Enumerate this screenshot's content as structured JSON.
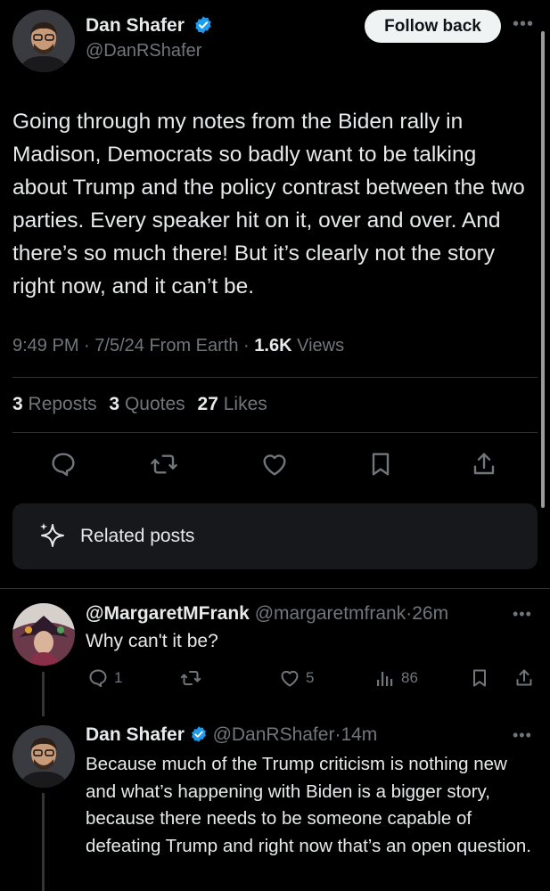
{
  "main_tweet": {
    "author_name": "Dan Shafer",
    "author_handle": "@DanRShafer",
    "follow_label": "Follow back",
    "text": "Going through my notes from the Biden rally in Madison, Democrats so badly want to be talking about Trump and the policy contrast between the two parties. Every speaker hit on it, over and over. And there’s so much there! But it’s clearly not the story right now, and it can’t be.",
    "time": "9:49 PM",
    "date": "7/5/24",
    "source": "From Earth",
    "views_count": "1.6K",
    "views_label": "Views",
    "reposts_count": "3",
    "reposts_label": "Reposts",
    "quotes_count": "3",
    "quotes_label": "Quotes",
    "likes_count": "27",
    "likes_label": "Likes"
  },
  "related_posts_label": "Related posts",
  "reply1": {
    "author_name": "@MargaretMFrank",
    "author_handle": "@margaretmfrank",
    "time": "26m",
    "text": "Why can't it be?",
    "replies": "1",
    "likes": "5",
    "views": "86"
  },
  "reply2": {
    "author_name": "Dan Shafer",
    "author_handle": "@DanRShafer",
    "time": "14m",
    "text": "Because much of the Trump criticism is nothing new and what’s happening with Biden is a bigger story, because there needs to be someone capable of defeating Trump and right now that’s an open question."
  },
  "sep": "·",
  "colors": {
    "accent": "#1d9bf0",
    "muted": "#71767b",
    "text": "#e7e9ea",
    "bg": "#000000",
    "card": "#16181c"
  }
}
